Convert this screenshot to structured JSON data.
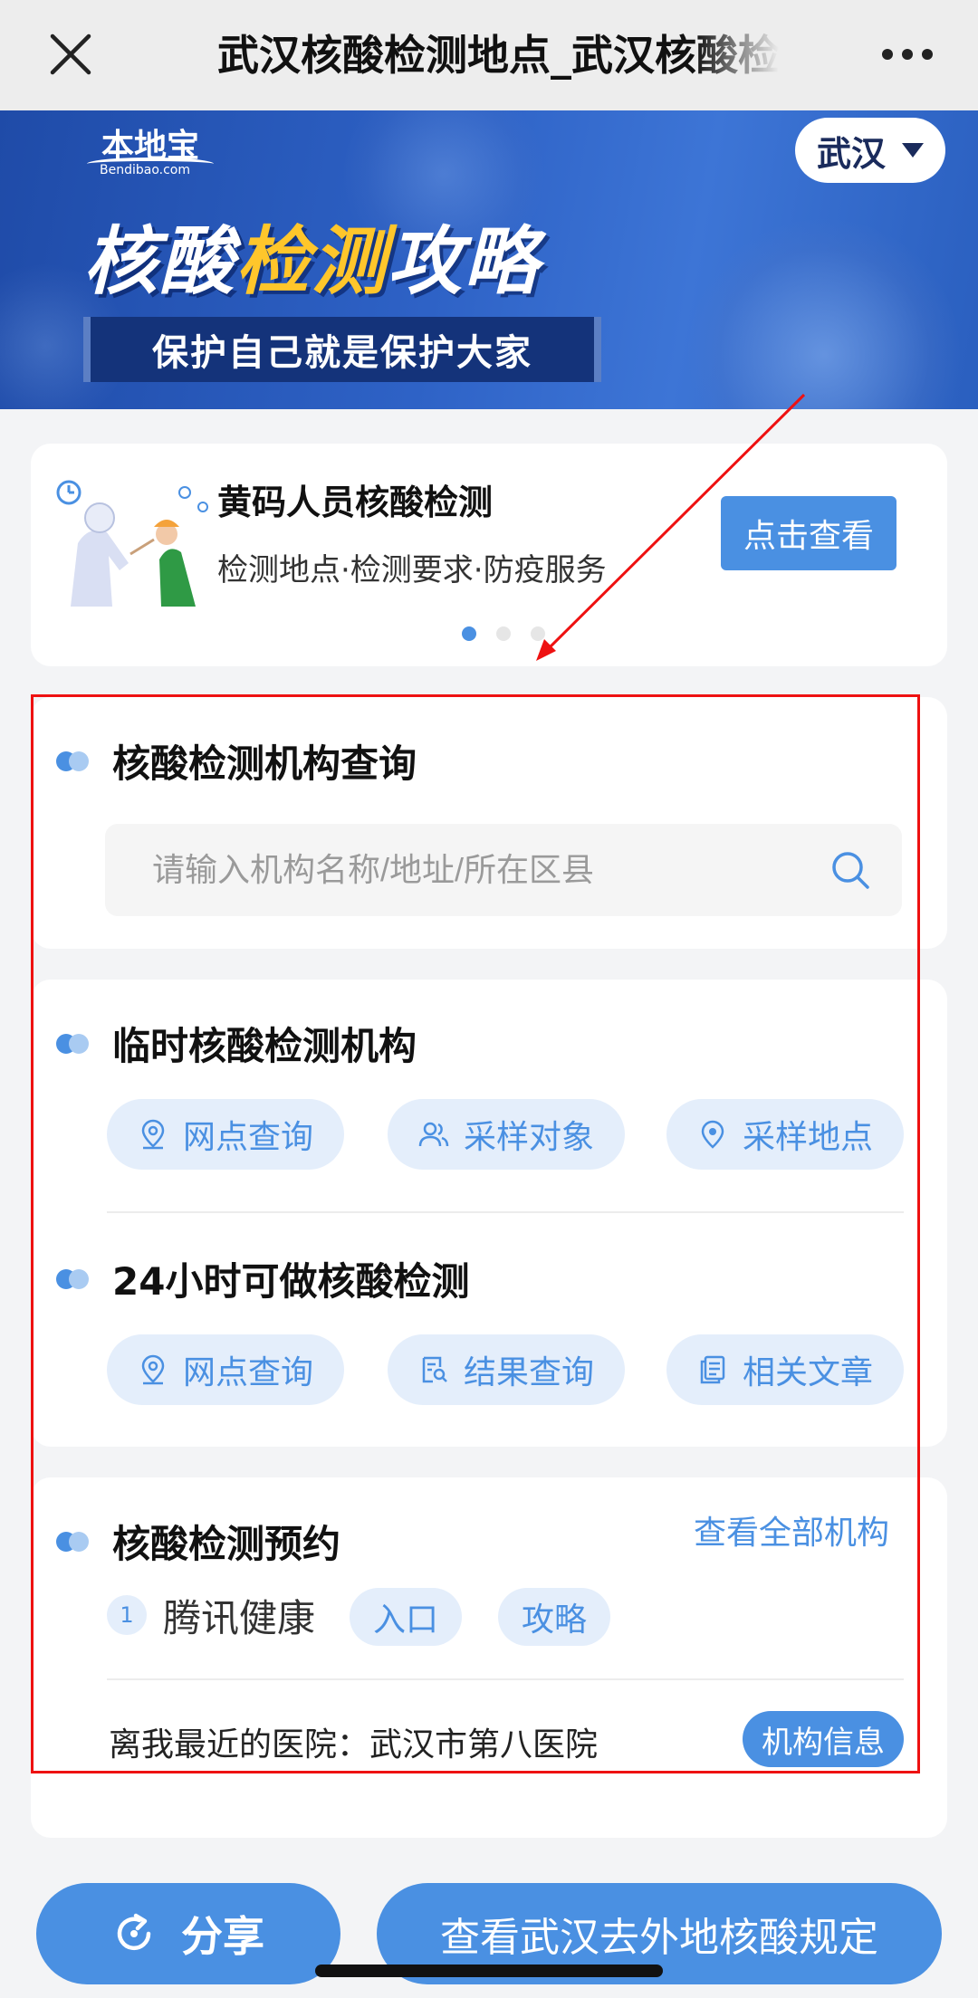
{
  "nav": {
    "title": "武汉核酸检测地点_武汉核酸检测地点"
  },
  "banner": {
    "logo_main": "本地宝",
    "logo_sub": "Bendibao.com",
    "city": "武汉",
    "title_part1": "核酸",
    "title_highlight": "检测",
    "title_part2": "攻略",
    "slogan": "保护自己就是保护大家",
    "colors": {
      "bg": "#2e62c6",
      "highlight": "#ffc62b"
    }
  },
  "promo": {
    "title": "黄码人员核酸检测",
    "subtitle": "检测地点·检测要求·防疫服务",
    "button": "点击查看",
    "active_slide": 1,
    "slide_count": 3
  },
  "query": {
    "title": "核酸检测机构查询",
    "placeholder": "请输入机构名称/地址/所在区县"
  },
  "temporary": {
    "title": "临时核酸检测机构",
    "chips": [
      {
        "label": "网点查询",
        "icon": "location-icon"
      },
      {
        "label": "采样对象",
        "icon": "people-icon"
      },
      {
        "label": "采样地点",
        "icon": "pin-icon"
      }
    ]
  },
  "hours24": {
    "title": "24小时可做核酸检测",
    "chips": [
      {
        "label": "网点查询",
        "icon": "location-icon"
      },
      {
        "label": "结果查询",
        "icon": "search-doc-icon"
      },
      {
        "label": "相关文章",
        "icon": "article-icon"
      }
    ]
  },
  "booking": {
    "title": "核酸检测预约",
    "all_link": "查看全部机构",
    "item_number": "1",
    "service": "腾讯健康",
    "tag_entry": "入口",
    "tag_guide": "攻略",
    "nearest_label": "离我最近的医院：",
    "nearest_hospital": "武汉市第八医院",
    "info_button": "机构信息"
  },
  "bottom": {
    "share": "分享",
    "rules": "查看武汉去外地核酸规定"
  },
  "theme": {
    "accent": "#4a90e2",
    "chip_bg": "#e4eefb",
    "annotation": "#e11111"
  }
}
